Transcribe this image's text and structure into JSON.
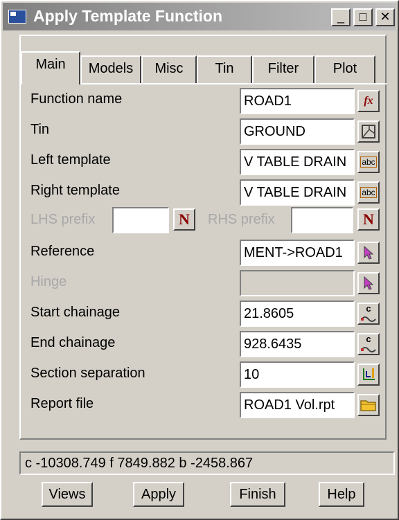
{
  "window": {
    "title": "Apply Template Function",
    "minimize_label": "_",
    "maximize_label": "□",
    "close_label": "✕"
  },
  "tabs": [
    {
      "label": "Main",
      "active": true
    },
    {
      "label": "Models"
    },
    {
      "label": "Misc"
    },
    {
      "label": "Tin"
    },
    {
      "label": "Filter"
    },
    {
      "label": "Plot"
    }
  ],
  "form": {
    "function_name": {
      "label": "Function name",
      "value": "ROAD1",
      "icon": "function-icon"
    },
    "tin": {
      "label": "Tin",
      "value": "GROUND",
      "icon": "tin-icon"
    },
    "left_template": {
      "label": "Left  template",
      "value": "V TABLE DRAIN",
      "icon": "abc-icon"
    },
    "right_template": {
      "label": "Right template",
      "value": "V TABLE DRAIN",
      "icon": "abc-icon"
    },
    "lhs_prefix": {
      "label": "LHS prefix",
      "value": "",
      "icon": "n-icon"
    },
    "rhs_prefix": {
      "label": "RHS prefix",
      "value": "",
      "icon": "n-icon"
    },
    "reference": {
      "label": "Reference",
      "value": "MENT->ROAD1",
      "icon": "pick-arrow-icon"
    },
    "hinge": {
      "label": "Hinge",
      "value": "",
      "icon": "pick-arrow-icon"
    },
    "start_chainage": {
      "label": "Start chainage",
      "value": "21.8605",
      "icon": "chainage-icon"
    },
    "end_chainage": {
      "label": "End chainage",
      "value": "928.6435",
      "icon": "chainage-icon"
    },
    "section_separation": {
      "label": "Section separation",
      "value": "10",
      "icon": "separation-icon"
    },
    "report_file": {
      "label": "Report file",
      "value": "ROAD1 Vol.rpt",
      "icon": "folder-icon"
    },
    "function_icon_text": "fx",
    "abc_icon_text": "abc",
    "n_icon_text": "N",
    "chainage_icon_text": "c"
  },
  "status_text": "c -10308.749 f  7849.882 b  -2458.867",
  "buttons": {
    "views": "Views",
    "apply": "Apply",
    "finish": "Finish",
    "help": "Help"
  },
  "colors": {
    "title_gradient_start": "#808080",
    "title_gradient_end": "#c0c0c0",
    "dialog_bg": "#d4d0c8",
    "folder": "#f2c230",
    "pick_arrow": "#c040c0",
    "function_icon": "#8b0000"
  }
}
